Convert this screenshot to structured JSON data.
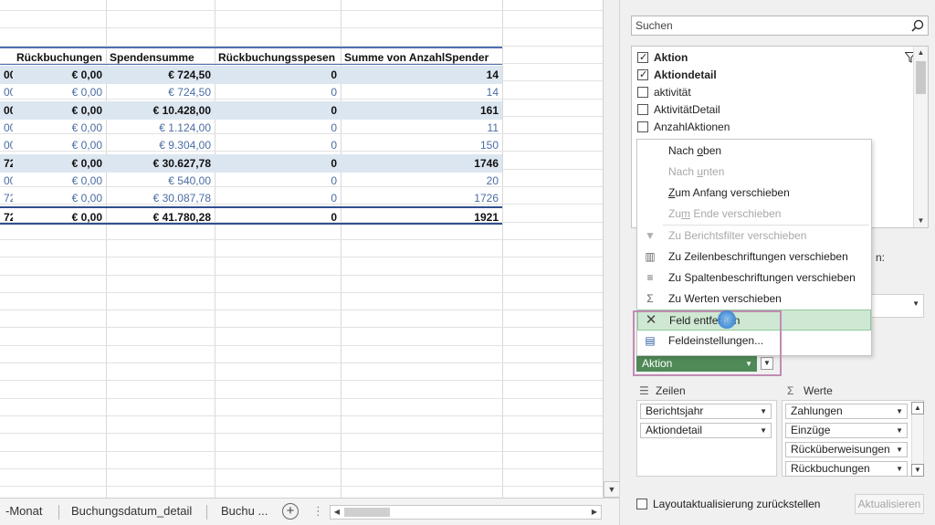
{
  "pivot": {
    "headers": [
      "Rückbuchungen",
      "Spendensumme",
      "Rückbuchungsspesen",
      "Summe von AnzahlSpender"
    ],
    "rows": [
      {
        "type": "sub",
        "lead": "00",
        "cells": [
          "€ 0,00",
          "€ 724,50",
          "0",
          "14"
        ]
      },
      {
        "type": "det",
        "lead": "00",
        "cells": [
          "€ 0,00",
          "€ 724,50",
          "0",
          "14"
        ]
      },
      {
        "type": "sub",
        "lead": "00",
        "cells": [
          "€ 0,00",
          "€ 10.428,00",
          "0",
          "161"
        ]
      },
      {
        "type": "det",
        "lead": "00",
        "cells": [
          "€ 0,00",
          "€ 1.124,00",
          "0",
          "11"
        ]
      },
      {
        "type": "det",
        "lead": "00",
        "cells": [
          "€ 0,00",
          "€ 9.304,00",
          "0",
          "150"
        ]
      },
      {
        "type": "sub",
        "lead": "72",
        "cells": [
          "€ 0,00",
          "€ 30.627,78",
          "0",
          "1746"
        ]
      },
      {
        "type": "det",
        "lead": "00",
        "cells": [
          "€ 0,00",
          "€ 540,00",
          "0",
          "20"
        ]
      },
      {
        "type": "det",
        "lead": "72",
        "cells": [
          "€ 0,00",
          "€ 30.087,78",
          "0",
          "1726"
        ]
      },
      {
        "type": "tot",
        "lead": "72",
        "cells": [
          "€ 0,00",
          "€ 41.780,28",
          "0",
          "1921"
        ]
      }
    ]
  },
  "tabs": {
    "items": [
      "-Monat",
      "Buchungsdatum_detail",
      "Buchu ..."
    ],
    "add": "+",
    "more": "⋮"
  },
  "fieldpane": {
    "search_placeholder": "Suchen",
    "fields": [
      {
        "label": "Aktion",
        "checked": true
      },
      {
        "label": "Aktiondetail",
        "checked": true
      },
      {
        "label": "aktivität",
        "checked": false
      },
      {
        "label": "AktivitätDetail",
        "checked": false
      },
      {
        "label": "AnzahlAktionen",
        "checked": false
      }
    ],
    "areas_partial": "n:",
    "filter_chip": "Aktion",
    "rows_header": "Zeilen",
    "values_header": "Werte",
    "rows_items": [
      "Berichtsjahr",
      "Aktiondetail"
    ],
    "values_items": [
      "Zahlungen",
      "Einzüge",
      "Rücküberweisungen",
      "Rückbuchungen"
    ],
    "defer_label": "Layoutaktualisierung zurückstellen",
    "update_label": "Aktualisieren"
  },
  "menu": {
    "items": [
      {
        "pre": "Nach ",
        "u": "o",
        "post": "ben",
        "disabled": false,
        "icon": ""
      },
      {
        "pre": "Nach ",
        "u": "u",
        "post": "nten",
        "disabled": true,
        "icon": ""
      },
      {
        "pre": "",
        "u": "Z",
        "post": "um Anfang verschieben",
        "disabled": false,
        "icon": ""
      },
      {
        "pre": "Zu",
        "u": "m",
        "post": " Ende verschieben",
        "disabled": true,
        "icon": ""
      },
      {
        "pre": "Zu Berichtsfilter verschieben",
        "u": "",
        "post": "",
        "disabled": true,
        "icon": "filter-icon"
      },
      {
        "pre": "Zu Zeilenbeschriftungen verschieben",
        "u": "",
        "post": "",
        "disabled": false,
        "icon": "rows-icon"
      },
      {
        "pre": "Zu Spaltenbeschriftungen verschieben",
        "u": "",
        "post": "",
        "disabled": false,
        "icon": "columns-icon"
      },
      {
        "pre": "Zu Werten verschieben",
        "u": "",
        "post": "",
        "disabled": false,
        "icon": "sigma-icon"
      },
      {
        "pre": "Feld entfe",
        "u": "",
        "post": "rnen",
        "disabled": false,
        "icon": "remove-icon"
      },
      {
        "pre": "Feldeinstellungen...",
        "u": "",
        "post": "",
        "disabled": false,
        "icon": "field-settings-icon"
      }
    ]
  }
}
